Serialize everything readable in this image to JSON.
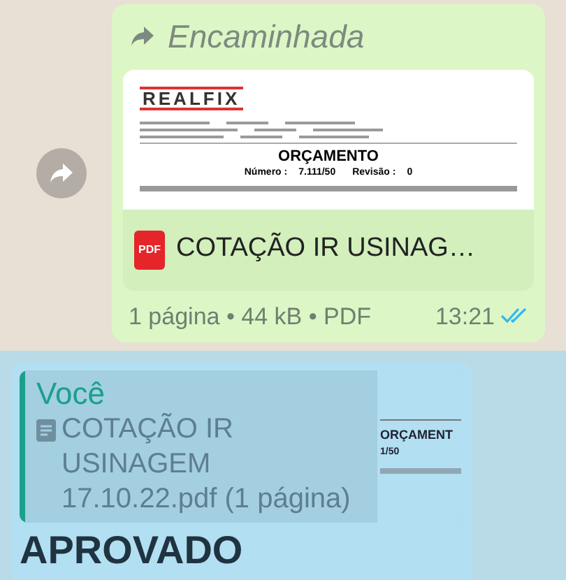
{
  "message_forwarded": {
    "forwarded_label": "Encaminhada",
    "document_preview": {
      "logo": "REALFIX",
      "title": "ORÇAMENTO",
      "fields": [
        {
          "label": "Número :",
          "value": "7.111/50"
        },
        {
          "label": "Revisão :",
          "value": "0"
        }
      ]
    },
    "file_type_badge": "PDF",
    "file_name": "COTAÇÃO IR USINAG…",
    "meta": "1 página • 44 kB • PDF",
    "time": "13:21",
    "read": true
  },
  "message_reply": {
    "selected": true,
    "quote": {
      "author": "Você",
      "text": "COTAÇÃO IR USINAGEM 17.10.22.pdf (1 página)",
      "thumbnail": {
        "title": "ORÇAMENT",
        "number": "1/50"
      }
    },
    "text": "APROVADO"
  }
}
